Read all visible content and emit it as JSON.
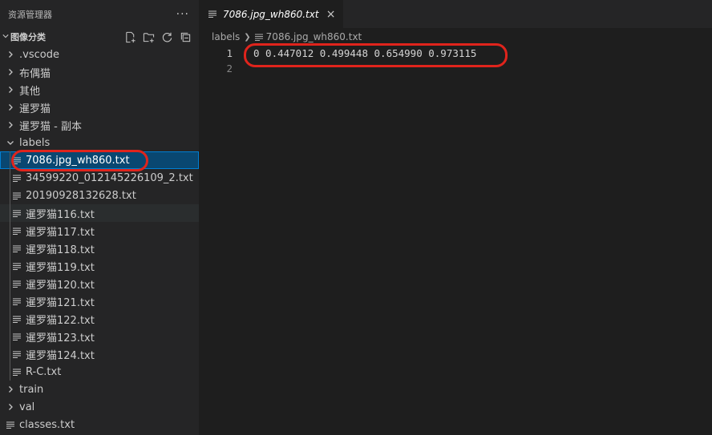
{
  "explorer": {
    "title": "资源管理器",
    "more": "···",
    "section": "图像分类",
    "actions": [
      "new-file-icon",
      "new-folder-icon",
      "refresh-icon",
      "collapse-all-icon"
    ]
  },
  "tree": [
    {
      "label": ".vscode",
      "type": "folder",
      "expanded": false,
      "depth": 0
    },
    {
      "label": "布偶猫",
      "type": "folder",
      "expanded": false,
      "depth": 0
    },
    {
      "label": "其他",
      "type": "folder",
      "expanded": false,
      "depth": 0
    },
    {
      "label": "暹罗猫",
      "type": "folder",
      "expanded": false,
      "depth": 0
    },
    {
      "label": "暹罗猫 - 副本",
      "type": "folder",
      "expanded": false,
      "depth": 0
    },
    {
      "label": "labels",
      "type": "folder",
      "expanded": true,
      "depth": 0
    },
    {
      "label": "7086.jpg_wh860.txt",
      "type": "file",
      "depth": 1,
      "selected": true
    },
    {
      "label": "34599220_012145226109_2.txt",
      "type": "file",
      "depth": 1
    },
    {
      "label": "20190928132628.txt",
      "type": "file",
      "depth": 1
    },
    {
      "label": "暹罗猫116.txt",
      "type": "file",
      "depth": 1,
      "hover": true
    },
    {
      "label": "暹罗猫117.txt",
      "type": "file",
      "depth": 1
    },
    {
      "label": "暹罗猫118.txt",
      "type": "file",
      "depth": 1
    },
    {
      "label": "暹罗猫119.txt",
      "type": "file",
      "depth": 1
    },
    {
      "label": "暹罗猫120.txt",
      "type": "file",
      "depth": 1
    },
    {
      "label": "暹罗猫121.txt",
      "type": "file",
      "depth": 1
    },
    {
      "label": "暹罗猫122.txt",
      "type": "file",
      "depth": 1
    },
    {
      "label": "暹罗猫123.txt",
      "type": "file",
      "depth": 1
    },
    {
      "label": "暹罗猫124.txt",
      "type": "file",
      "depth": 1
    },
    {
      "label": "R-C.txt",
      "type": "file",
      "depth": 1
    },
    {
      "label": "train",
      "type": "folder",
      "expanded": false,
      "depth": 0
    },
    {
      "label": "val",
      "type": "folder",
      "expanded": false,
      "depth": 0
    },
    {
      "label": "classes.txt",
      "type": "file",
      "depth": 0
    }
  ],
  "editor": {
    "tab": {
      "label": "7086.jpg_wh860.txt",
      "close": "×"
    },
    "breadcrumbs": [
      {
        "label": "labels",
        "sep": "❯"
      },
      {
        "label": "7086.jpg_wh860.txt"
      }
    ],
    "lines": [
      {
        "number": "1",
        "text": "0 0.447012 0.499448 0.654990 0.973115"
      },
      {
        "number": "2",
        "text": ""
      }
    ]
  },
  "colors": {
    "sidebar_bg": "#252526",
    "editor_bg": "#1e1e1e",
    "selected_bg": "#094771",
    "selected_border": "#007fd4",
    "annotation": "#e0241c"
  }
}
